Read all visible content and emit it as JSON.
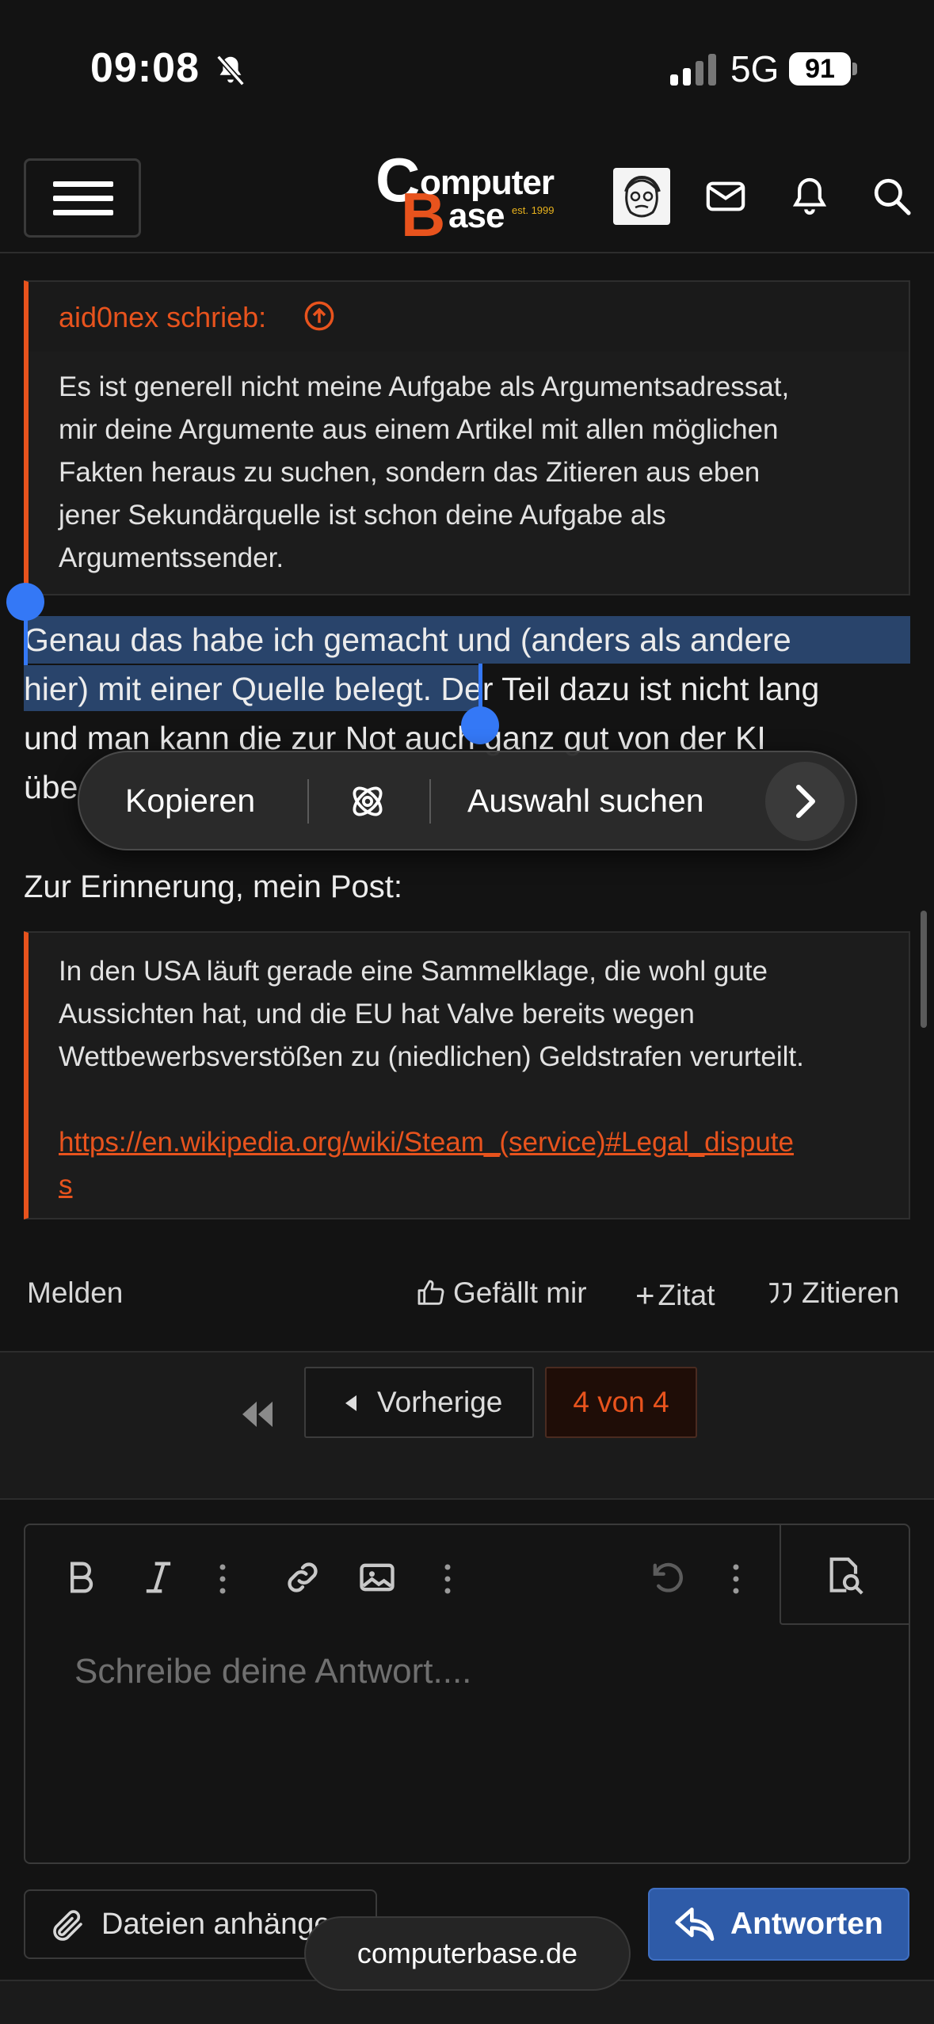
{
  "status_bar": {
    "time": "09:08",
    "network": "5G",
    "battery": "91"
  },
  "header": {
    "logo_word_1": "omputer",
    "logo_word_2": "ase",
    "logo_tagline": "est. 1999"
  },
  "quote1": {
    "author": "aid0nex schrieb:",
    "lines": [
      "Es ist generell nicht meine Aufgabe als Argumentsadressat,",
      "mir deine Argumente aus einem Artikel mit allen möglichen",
      "Fakten heraus zu suchen, sondern das Zitieren aus eben",
      "jener Sekundärquelle ist schon deine Aufgabe als",
      "Argumentssender."
    ]
  },
  "post": {
    "line1": "Genau das habe ich gemacht und (anders als andere",
    "line2_selected": "hier) mit einer Quelle belegt.",
    "line2_rest": " Der Teil dazu ist nicht lang",
    "line3": "und man kann die zur Not auch ganz gut von der KI",
    "line4_start": "übe",
    "reminder": "Zur Erinnerung, mein Post:"
  },
  "context_menu": {
    "copy": "Kopieren",
    "search": "Auswahl suchen"
  },
  "quote2": {
    "lines": [
      "In den USA läuft gerade eine Sammelklage, die wohl gute",
      "Aussichten hat, und die EU hat Valve bereits wegen",
      "Wettbewerbsverstößen zu (niedlichen) Geldstrafen verurteilt."
    ],
    "link_line1": "https://en.wikipedia.org/wiki/Steam_(service)#Legal_dispute",
    "link_line2": "s"
  },
  "actions": {
    "report": "Melden",
    "like": "Gefällt mir",
    "quote_plus": "Zitat",
    "quote": "Zitieren"
  },
  "pagination": {
    "prev": "Vorherige",
    "current": "4 von 4"
  },
  "editor": {
    "placeholder": "Schreibe deine Antwort...."
  },
  "footer": {
    "attach": "Dateien anhängen",
    "reply": "Antworten",
    "url": "computerbase.de"
  },
  "colors": {
    "accent": "#e8531d",
    "selection": "#29446b",
    "handle": "#3478f6",
    "reply": "#2e5ba8"
  }
}
